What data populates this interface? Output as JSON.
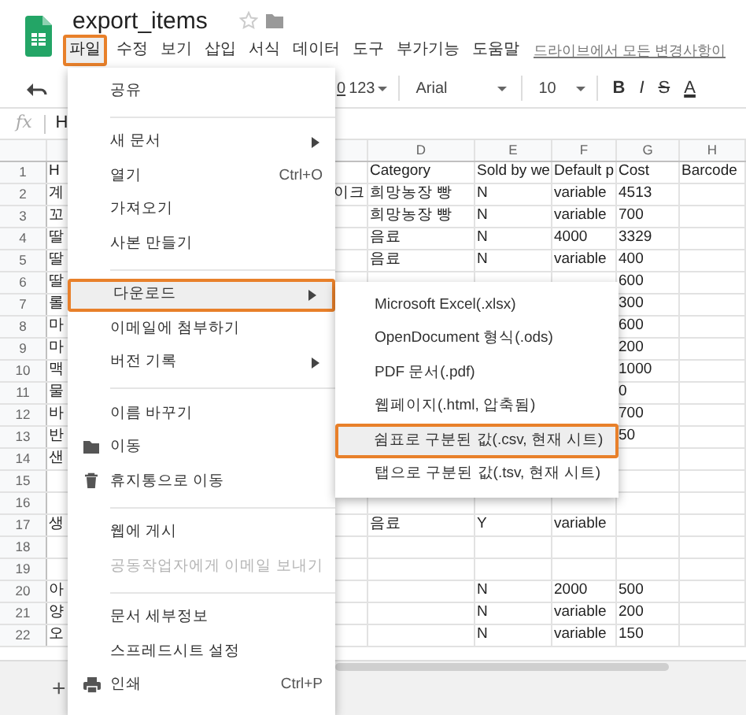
{
  "header": {
    "title": "export_items",
    "drive_status": "드라이브에서 모든 변경사항이",
    "menus": [
      {
        "label": "파일",
        "selected": true
      },
      {
        "label": "수정",
        "selected": false
      },
      {
        "label": "보기",
        "selected": false
      },
      {
        "label": "삽입",
        "selected": false
      },
      {
        "label": "서식",
        "selected": false
      },
      {
        "label": "데이터",
        "selected": false
      },
      {
        "label": "도구",
        "selected": false
      },
      {
        "label": "부가기능",
        "selected": false
      },
      {
        "label": "도움말",
        "selected": false
      }
    ]
  },
  "toolbar": {
    "decimal_fragment": "0",
    "number_format": "123",
    "font": "Arial",
    "font_size": "10",
    "text_styles": [
      "B",
      "I",
      "S",
      "A"
    ]
  },
  "formula_bar": {
    "label": "fx",
    "value": "H"
  },
  "sheet": {
    "columns": [
      "D",
      "E",
      "F",
      "G",
      "H"
    ],
    "rows": [
      {
        "number": "1",
        "cells": {
          "a": "H",
          "d": "Category",
          "e": "Sold by we",
          "f": "Default p",
          "g": "Cost",
          "h": "Barcode"
        }
      },
      {
        "number": "2",
        "cells": {
          "a": "계",
          "c": "이크",
          "d": "희망농장 빵",
          "e": "N",
          "f": "variable",
          "g": "4513"
        }
      },
      {
        "number": "3",
        "cells": {
          "a": "꼬",
          "d": "희망농장 빵",
          "e": "N",
          "f": "variable",
          "g": "700"
        }
      },
      {
        "number": "4",
        "cells": {
          "a": "딸",
          "d": "음료",
          "e": "N",
          "f": "4000",
          "g": "3329"
        }
      },
      {
        "number": "5",
        "cells": {
          "a": "딸",
          "d": "음료",
          "e": "N",
          "f": "variable",
          "g": "400"
        }
      },
      {
        "number": "6",
        "cells": {
          "a": "딸",
          "g": "600"
        }
      },
      {
        "number": "7",
        "cells": {
          "a": "롤",
          "g": "300"
        }
      },
      {
        "number": "8",
        "cells": {
          "a": "마",
          "g": "600"
        }
      },
      {
        "number": "9",
        "cells": {
          "a": "마",
          "g": "200"
        }
      },
      {
        "number": "10",
        "cells": {
          "a": "맥",
          "g": "1000"
        }
      },
      {
        "number": "11",
        "cells": {
          "a": "물",
          "g": "0"
        }
      },
      {
        "number": "12",
        "cells": {
          "a": "바",
          "g": "700"
        }
      },
      {
        "number": "13",
        "cells": {
          "a": "반",
          "g": "50"
        }
      },
      {
        "number": "14",
        "cells": {
          "a": "샌"
        }
      },
      {
        "number": "15",
        "cells": {}
      },
      {
        "number": "16",
        "cells": {}
      },
      {
        "number": "17",
        "cells": {
          "a": "생",
          "d": "음료",
          "e": "Y",
          "f": "variable"
        }
      },
      {
        "number": "18",
        "cells": {}
      },
      {
        "number": "19",
        "cells": {}
      },
      {
        "number": "20",
        "cells": {
          "a": "아",
          "e": "N",
          "f": "2000",
          "g": "500"
        }
      },
      {
        "number": "21",
        "cells": {
          "a": "양",
          "e": "N",
          "f": "variable",
          "g": "200"
        }
      },
      {
        "number": "22",
        "cells": {
          "a": "오",
          "e": "N",
          "f": "variable",
          "g": "150"
        }
      }
    ]
  },
  "file_menu": [
    {
      "kind": "item",
      "label": "공유",
      "selected": false
    },
    {
      "kind": "separator"
    },
    {
      "kind": "item",
      "label": "새 문서",
      "submenu": true,
      "selected": false
    },
    {
      "kind": "item",
      "label": "열기",
      "shortcut": "Ctrl+O",
      "selected": false
    },
    {
      "kind": "item",
      "label": "가져오기",
      "selected": false
    },
    {
      "kind": "item",
      "label": "사본 만들기",
      "selected": false
    },
    {
      "kind": "separator"
    },
    {
      "kind": "item",
      "label": "다운로드",
      "submenu": true,
      "selected": true
    },
    {
      "kind": "item",
      "label": "이메일에 첨부하기",
      "selected": false
    },
    {
      "kind": "item",
      "label": "버전 기록",
      "submenu": true,
      "selected": false
    },
    {
      "kind": "separator"
    },
    {
      "kind": "item",
      "label": "이름 바꾸기",
      "selected": false
    },
    {
      "kind": "move",
      "label": "이동",
      "selected": false
    },
    {
      "kind": "trash",
      "label": "휴지통으로 이동",
      "selected": false
    },
    {
      "kind": "separator"
    },
    {
      "kind": "item",
      "label": "웹에 게시",
      "selected": false
    },
    {
      "kind": "item",
      "label": "공동작업자에게 이메일 보내기",
      "disabled": true,
      "selected": false
    },
    {
      "kind": "separator"
    },
    {
      "kind": "item",
      "label": "문서 세부정보",
      "selected": false
    },
    {
      "kind": "item",
      "label": "스프레드시트 설정",
      "selected": false
    },
    {
      "kind": "print",
      "label": "인쇄",
      "shortcut": "Ctrl+P",
      "selected": false
    }
  ],
  "download_submenu": [
    {
      "label": "Microsoft Excel(.xlsx)",
      "selected": false
    },
    {
      "label": "OpenDocument 형식(.ods)",
      "selected": false
    },
    {
      "label": "PDF 문서(.pdf)",
      "selected": false
    },
    {
      "label": "웹페이지(.html, 압축됨)",
      "selected": false
    },
    {
      "label": "쉼표로 구분된 값(.csv, 현재 시트)",
      "selected": true
    },
    {
      "label": "탭으로 구분된 값(.tsv, 현재 시트)",
      "selected": false
    }
  ],
  "sheet_tabs": {
    "add": "+"
  }
}
